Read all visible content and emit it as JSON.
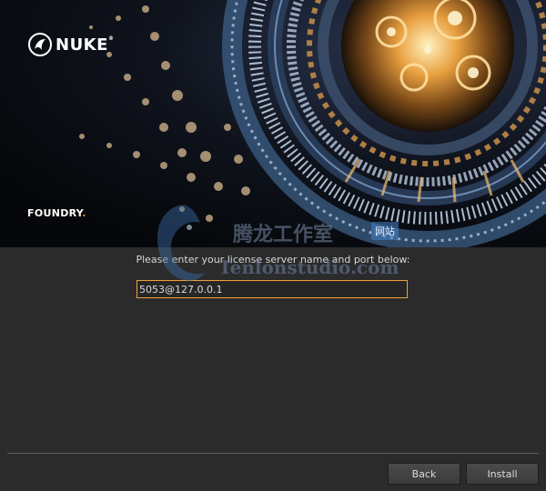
{
  "banner": {
    "product_name": "NUKE",
    "trademark": "®",
    "company": "FOUNDRY",
    "company_dot": "."
  },
  "form": {
    "prompt": "Please enter your license server name and port below:",
    "license_value": "5053@127.0.0.1"
  },
  "watermark": {
    "chinese_text": "腾龙工作室",
    "badge": "网站",
    "english_text": "Tenlonstudio.com"
  },
  "buttons": {
    "back": "Back",
    "install": "Install"
  },
  "colors": {
    "accent_orange": "#f08a24",
    "input_border": "#f0a040",
    "panel_bg": "#2b2b2b"
  }
}
